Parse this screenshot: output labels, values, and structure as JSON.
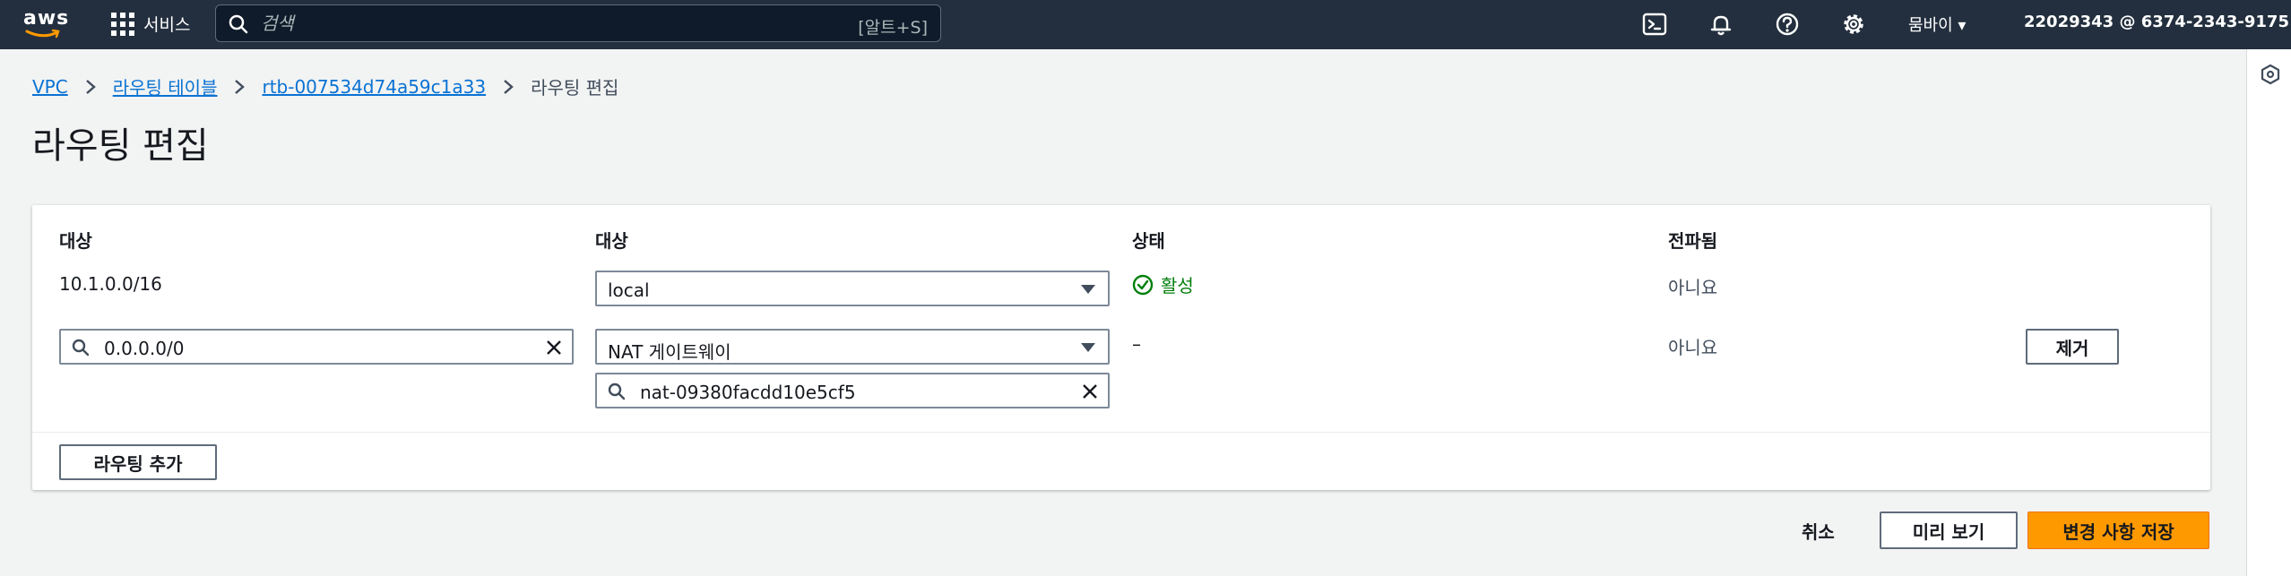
{
  "nav": {
    "logo_text": "aws",
    "services_label": "서비스",
    "search_placeholder": "검색",
    "search_shortcut": "[알트+S]",
    "region_label": "뭄바이 ▾",
    "account_label": "22029343 @ 6374-2343-9175 ▾",
    "icons": [
      "cloudshell-icon",
      "bell-icon",
      "help-icon",
      "settings-icon"
    ]
  },
  "breadcrumb": {
    "items": [
      "VPC",
      "라우팅 테이블",
      "rtb-007534d74a59c1a33"
    ],
    "current": "라우팅 편집"
  },
  "page_title": "라우팅 편집",
  "table": {
    "headers": [
      "대상",
      "대상",
      "상태",
      "전파됨"
    ],
    "rows": [
      {
        "destination": "10.1.0.0/16",
        "target": "local",
        "status": "활성",
        "propagated": "아니요"
      },
      {
        "destination": "0.0.0.0/0",
        "target": "NAT 게이트웨이",
        "target_id": "nat-09380facdd10e5cf5",
        "status": "–",
        "propagated": "아니요",
        "remove_label": "제거"
      }
    ],
    "add_route_label": "라우팅 추가"
  },
  "footer": {
    "cancel_label": "취소",
    "preview_label": "미리 보기",
    "save_label": "변경 사항 저장"
  },
  "colors": {
    "nav_bg": "#232f3e",
    "link": "#0972d3",
    "success": "#037f0c",
    "primary": "#ff9900"
  }
}
